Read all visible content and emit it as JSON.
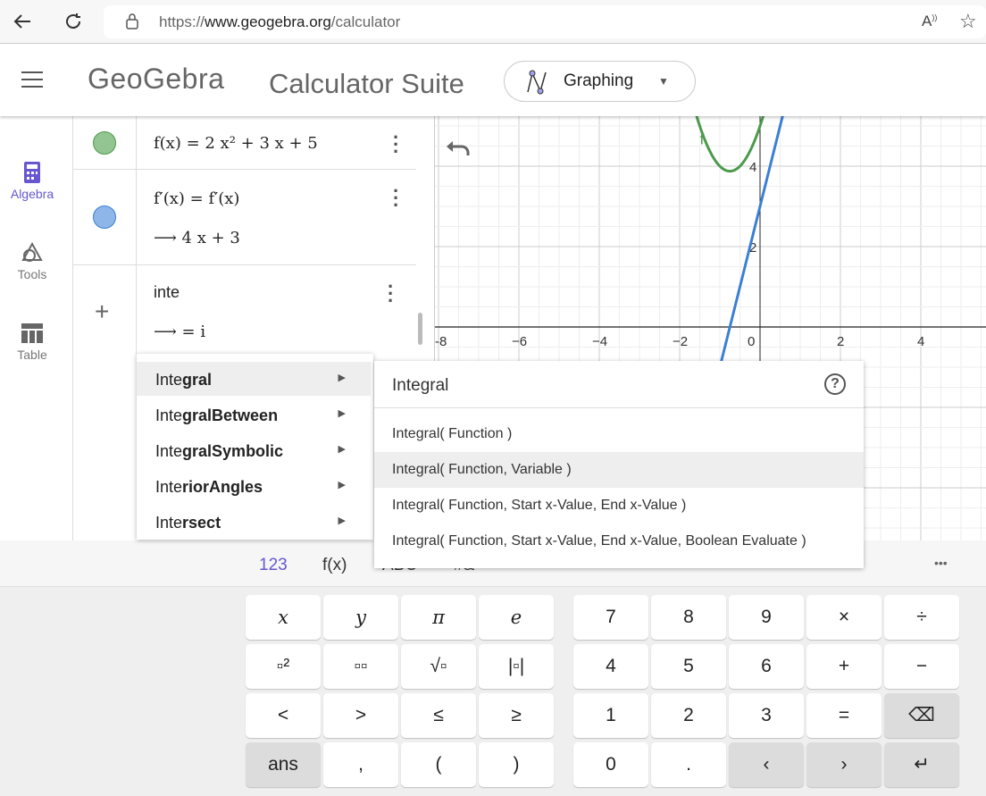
{
  "browser": {
    "url_prefix": "https://",
    "url_domain": "www.geogebra.org",
    "url_path": "/calculator",
    "icons": [
      "back-arrow-icon",
      "reload-icon",
      "lock-icon",
      "read-aloud-icon",
      "favorite-icon"
    ]
  },
  "header": {
    "logo": "GeoGebra",
    "title": "Calculator Suite",
    "app_selector": "Graphing"
  },
  "sidebar": {
    "items": [
      {
        "label": "Algebra",
        "active": true
      },
      {
        "label": "Tools"
      },
      {
        "label": "Table"
      }
    ]
  },
  "algebra": {
    "rows": [
      {
        "expr": "f(x) = 2 x² + 3 x + 5",
        "color": "#93c593"
      },
      {
        "expr": "f′(x) = f′(x)",
        "output": "4 x + 3",
        "color": "#8fb6e8"
      },
      {
        "input": "inte",
        "output": "= i"
      }
    ],
    "arrow": "⟶"
  },
  "autocomplete": {
    "items": [
      {
        "typed": "Inte",
        "rest": "gral"
      },
      {
        "typed": "Inte",
        "rest": "gralBetween"
      },
      {
        "typed": "Inte",
        "rest": "gralSymbolic"
      },
      {
        "typed": "Inte",
        "rest": "riorAngles"
      },
      {
        "typed": "Inte",
        "rest": "rsect"
      }
    ]
  },
  "help": {
    "title": "Integral",
    "syntaxes": [
      "Integral( Function )",
      "Integral( Function, Variable )",
      "Integral( Function, Start x-Value, End x-Value )",
      "Integral( Function, Start x-Value, End x-Value, Boolean Evaluate )"
    ]
  },
  "graph": {
    "x_ticks": [
      "-8",
      "−6",
      "−4",
      "−2",
      "0",
      "2",
      "4"
    ],
    "y_ticks": [
      "2",
      "4"
    ],
    "curve_label": "f",
    "colors": {
      "f": "#4c9a4c",
      "derivative": "#3a7fd5"
    }
  },
  "keyboard": {
    "tabs": [
      "123",
      "f(x)",
      "ABC",
      "#&"
    ],
    "more": "•••",
    "left": [
      [
        "x",
        "y",
        "π",
        "e"
      ],
      [
        "▫²",
        "▫▫",
        "√▫",
        "|▫|"
      ],
      [
        "<",
        ">",
        "≤",
        "≥"
      ],
      [
        "ans",
        ",",
        "(",
        ")"
      ]
    ],
    "right": [
      [
        "7",
        "8",
        "9",
        "×",
        "÷"
      ],
      [
        "4",
        "5",
        "6",
        "+",
        "−"
      ],
      [
        "1",
        "2",
        "3",
        "=",
        "⌫"
      ],
      [
        "0",
        ".",
        "‹",
        "›",
        "↵"
      ]
    ]
  }
}
